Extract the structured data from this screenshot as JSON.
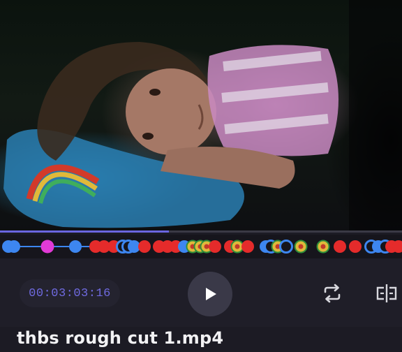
{
  "player": {
    "timecode": "00:03:03:16",
    "filename": "thbs rough cut 1.mp4",
    "progress": 0.42
  },
  "icons": {
    "play": "play-icon",
    "loop": "loop-icon",
    "split": "split-icon"
  },
  "colors": {
    "accent": "#6f6ae0",
    "marker_blue": "#3d86f0",
    "marker_magenta": "#e23ad6",
    "marker_red": "#e52b2b"
  }
}
